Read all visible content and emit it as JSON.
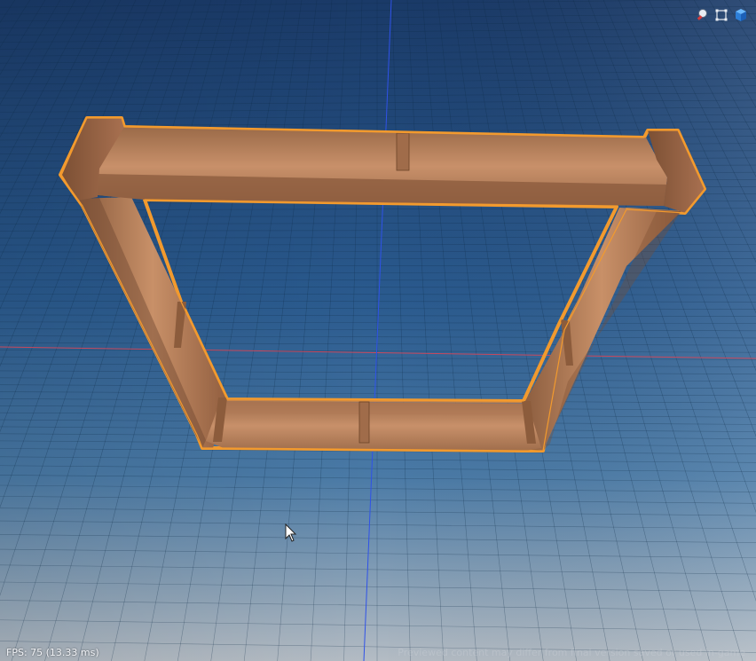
{
  "viewport": {
    "fps_text": "FPS: 75 (13.33 ms)",
    "disclaimer": "Previewed content may differ from final version saved or used in-game",
    "colors": {
      "sky_top": "#1c3e6c",
      "sky_bottom": "#c4ccd4",
      "grid_line": "#0e2a46",
      "x_axis": "#c8485c",
      "y_axis": "#2f52e8",
      "selection_outline": "#f29a2e",
      "wood_light": "#c08660",
      "wood_dark": "#7a4e32"
    }
  },
  "toolbar": {
    "buttons": [
      {
        "name": "lighting-toggle-button",
        "icon": "light-bulb-icon"
      },
      {
        "name": "bounding-box-toggle-button",
        "icon": "bounding-box-icon"
      },
      {
        "name": "model-view-button",
        "icon": "cube-icon"
      }
    ]
  },
  "selected_object": {
    "type": "wooden rectangular frame"
  }
}
